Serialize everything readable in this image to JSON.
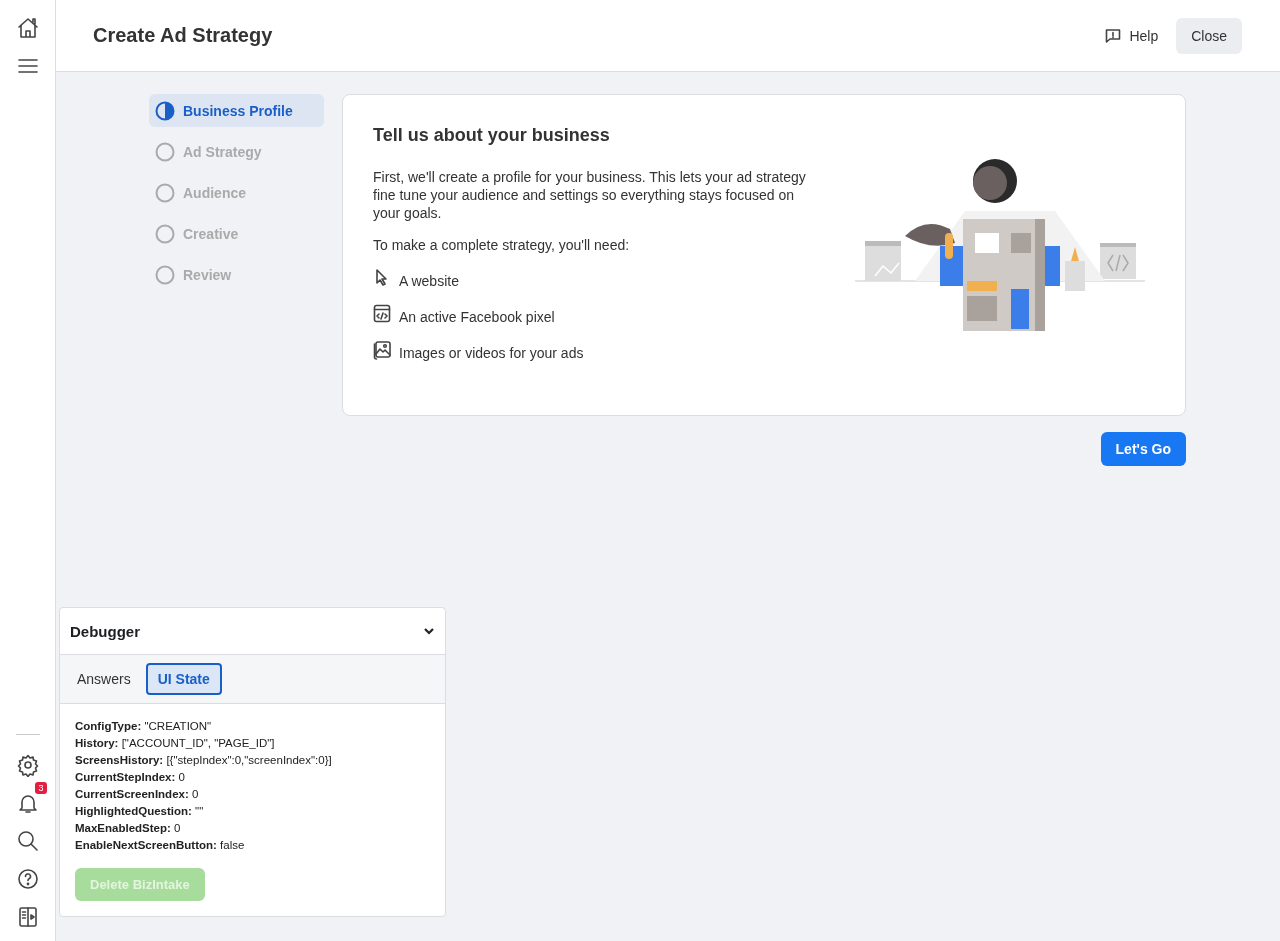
{
  "header": {
    "title": "Create Ad Strategy",
    "help": "Help",
    "close": "Close"
  },
  "rail": {
    "notification_count": "3"
  },
  "steps": [
    {
      "label": "Business Profile",
      "selected": true
    },
    {
      "label": "Ad Strategy",
      "selected": false
    },
    {
      "label": "Audience",
      "selected": false
    },
    {
      "label": "Creative",
      "selected": false
    },
    {
      "label": "Review",
      "selected": false
    }
  ],
  "card": {
    "title": "Tell us about your business",
    "intro": "First, we'll create a profile for your business. This lets your ad strategy fine tune your audience and settings so everything stays focused on your goals.",
    "needs_label": "To make a complete strategy, you'll need:",
    "requirements": [
      {
        "kind": "cursor",
        "text": "A website"
      },
      {
        "kind": "code",
        "text": "An active Facebook pixel"
      },
      {
        "kind": "image",
        "text": "Images or videos for your ads"
      }
    ]
  },
  "primary_button": "Let's Go",
  "debugger": {
    "title": "Debugger",
    "expanded": true,
    "tabs": [
      {
        "label": "Answers",
        "selected": false
      },
      {
        "label": "UI State",
        "selected": true
      }
    ],
    "fields": [
      {
        "key": "ConfigType:",
        "value": "\"CREATION\""
      },
      {
        "key": "History:",
        "value": "[\"ACCOUNT_ID\", \"PAGE_ID\"]"
      },
      {
        "key": "ScreensHistory:",
        "value": "[{\"stepIndex\":0,\"screenIndex\":0}]"
      },
      {
        "key": "CurrentStepIndex:",
        "value": "0"
      },
      {
        "key": "CurrentScreenIndex:",
        "value": "0"
      },
      {
        "key": "HighlightedQuestion:",
        "value": "\"\""
      },
      {
        "key": "MaxEnabledStep:",
        "value": "0"
      },
      {
        "key": "EnableNextScreenButton:",
        "value": "false"
      }
    ],
    "delete_button": {
      "label": "Delete BizIntake",
      "disabled": true
    }
  }
}
